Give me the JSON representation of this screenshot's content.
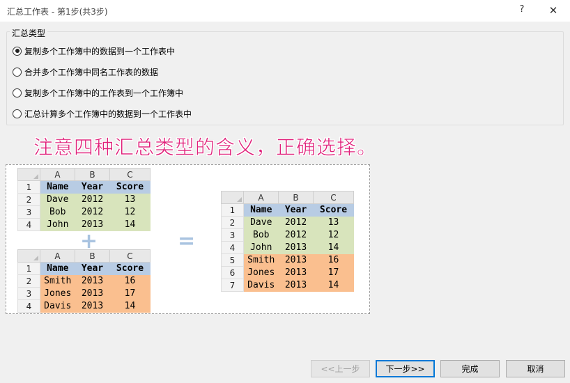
{
  "window": {
    "title": "汇总工作表 - 第1步(共3步)",
    "help": "?",
    "close": "✕"
  },
  "group": {
    "legend": "汇总类型",
    "options": [
      {
        "label": "复制多个工作簿中的数据到一个工作表中",
        "selected": true
      },
      {
        "label": "合并多个工作簿中同名工作表的数据",
        "selected": false
      },
      {
        "label": "复制多个工作簿中的工作表到一个工作簿中",
        "selected": false
      },
      {
        "label": "汇总计算多个工作簿中的数据到一个工作表中",
        "selected": false
      }
    ]
  },
  "note": "注意四种汇总类型的含义，正确选择。",
  "illustration": {
    "col_letters": [
      "A",
      "B",
      "C"
    ],
    "plus": "+",
    "equals": "=",
    "sheet1": {
      "row_nums": [
        "1",
        "2",
        "3",
        "4"
      ],
      "header": [
        "Name",
        "Year",
        "Score"
      ],
      "rows": [
        [
          "Dave",
          "2012",
          "13"
        ],
        [
          "Bob",
          "2012",
          "12"
        ],
        [
          "John",
          "2013",
          "14"
        ]
      ]
    },
    "sheet2": {
      "row_nums": [
        "1",
        "2",
        "3",
        "4"
      ],
      "header": [
        "Name",
        "Year",
        "Score"
      ],
      "rows": [
        [
          "Smith",
          "2013",
          "16"
        ],
        [
          "Jones",
          "2013",
          "17"
        ],
        [
          "Davis",
          "2013",
          "14"
        ]
      ]
    },
    "result": {
      "row_nums": [
        "1",
        "2",
        "3",
        "4",
        "5",
        "6",
        "7"
      ],
      "header": [
        "Name",
        "Year",
        "Score"
      ],
      "rows": [
        [
          "Dave",
          "2012",
          "13"
        ],
        [
          "Bob",
          "2012",
          "12"
        ],
        [
          "John",
          "2013",
          "14"
        ],
        [
          "Smith",
          "2013",
          "16"
        ],
        [
          "Jones",
          "2013",
          "17"
        ],
        [
          "Davis",
          "2013",
          "14"
        ]
      ]
    }
  },
  "buttons": {
    "prev": "<<上一步",
    "next": "下一步>>",
    "finish": "完成",
    "cancel": "取消"
  },
  "colors": {
    "note": "#e0207a",
    "header_fill": "#b8cce4",
    "green_fill": "#d8e4bc",
    "orange_fill": "#fabf8f"
  }
}
